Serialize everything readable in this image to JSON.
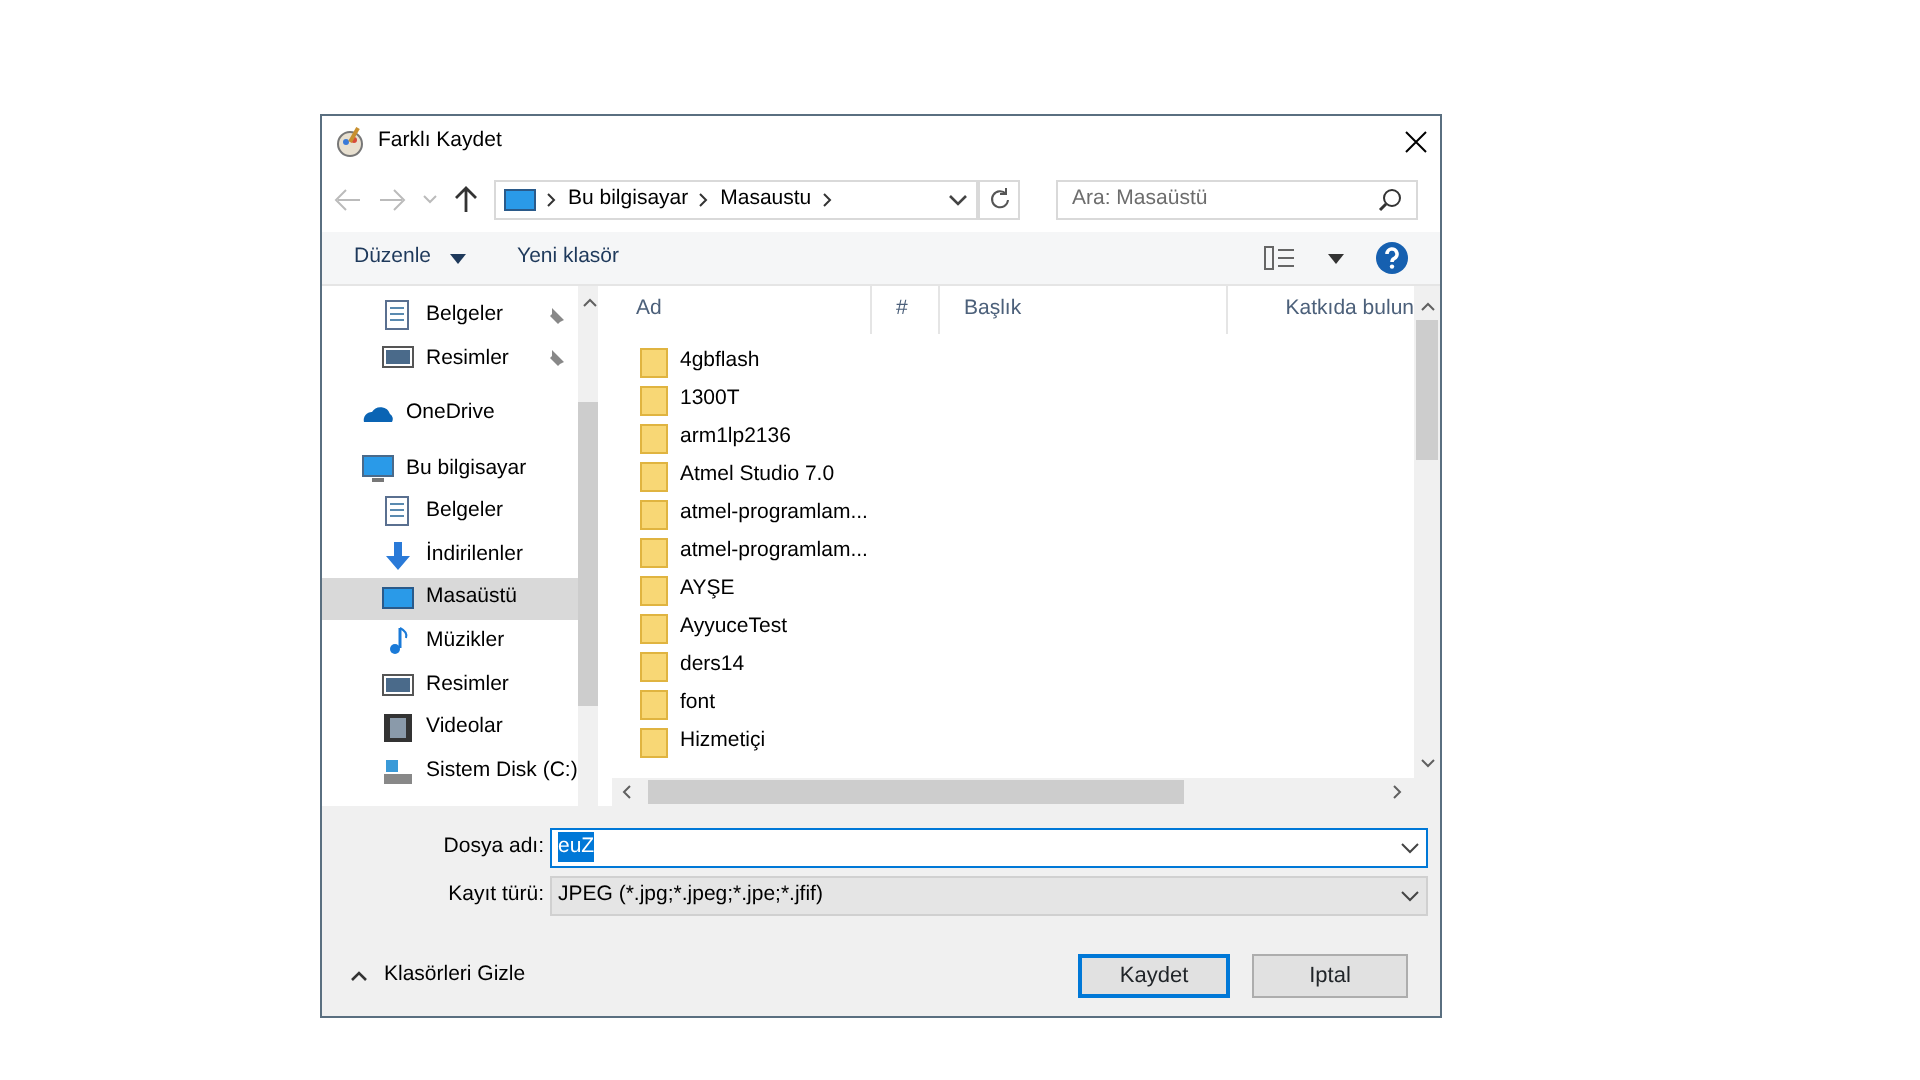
{
  "window": {
    "title": "Farklı Kaydet"
  },
  "address": {
    "crumbs": [
      "Bu bilgisayar",
      "Masaustu"
    ]
  },
  "search": {
    "placeholder": "Ara: Masaüstü"
  },
  "toolbar": {
    "organize": "Düzenle",
    "new_folder": "Yeni klasör"
  },
  "quick_access": [
    {
      "label": "Belgeler",
      "kind": "doc",
      "pinned": true,
      "selected": false
    },
    {
      "label": "Resimler",
      "kind": "picture",
      "pinned": true,
      "selected": false
    }
  ],
  "locations": [
    {
      "label": "OneDrive",
      "kind": "cloud",
      "selected": false
    },
    {
      "label": "Bu bilgisayar",
      "kind": "pc",
      "selected": false,
      "children": [
        {
          "label": "Belgeler",
          "kind": "doc",
          "selected": false
        },
        {
          "label": "İndirilenler",
          "kind": "download",
          "selected": false
        },
        {
          "label": "Masaüstü",
          "kind": "desktop",
          "selected": true
        },
        {
          "label": "Müzikler",
          "kind": "music",
          "selected": false
        },
        {
          "label": "Resimler",
          "kind": "picture",
          "selected": false
        },
        {
          "label": "Videolar",
          "kind": "video",
          "selected": false
        },
        {
          "label": "Sistem Disk (C:)",
          "kind": "disk",
          "selected": false
        }
      ]
    }
  ],
  "table": {
    "columns": [
      "Ad",
      "#",
      "Başlık",
      "Katkıda bulun"
    ],
    "rows": [
      {
        "name": "4gbflash",
        "selected": false
      },
      {
        "name": "1300T",
        "selected": false
      },
      {
        "name": "arm1lp2136",
        "selected": false
      },
      {
        "name": "Atmel Studio 7.0",
        "selected": false
      },
      {
        "name": "atmel-programlam...",
        "selected": false
      },
      {
        "name": "atmel-programlam...",
        "selected": false
      },
      {
        "name": "AYŞE",
        "selected": false
      },
      {
        "name": "AyyuceTest",
        "selected": false
      },
      {
        "name": "ders14",
        "selected": false
      },
      {
        "name": "font",
        "selected": false
      },
      {
        "name": "Hizmetiçi",
        "selected": false
      }
    ]
  },
  "file_name": {
    "label": "Dosya adı:",
    "value": "euZ",
    "value_selected": true
  },
  "file_type": {
    "label": "Kayıt türü:",
    "value": "JPEG (*.jpg;*.jpeg;*.jpe;*.jfif)"
  },
  "hide_folders": "Klasörleri Gizle",
  "buttons": [
    {
      "label": "Kaydet",
      "default": true
    },
    {
      "label": "Iptal",
      "default": false
    }
  ]
}
